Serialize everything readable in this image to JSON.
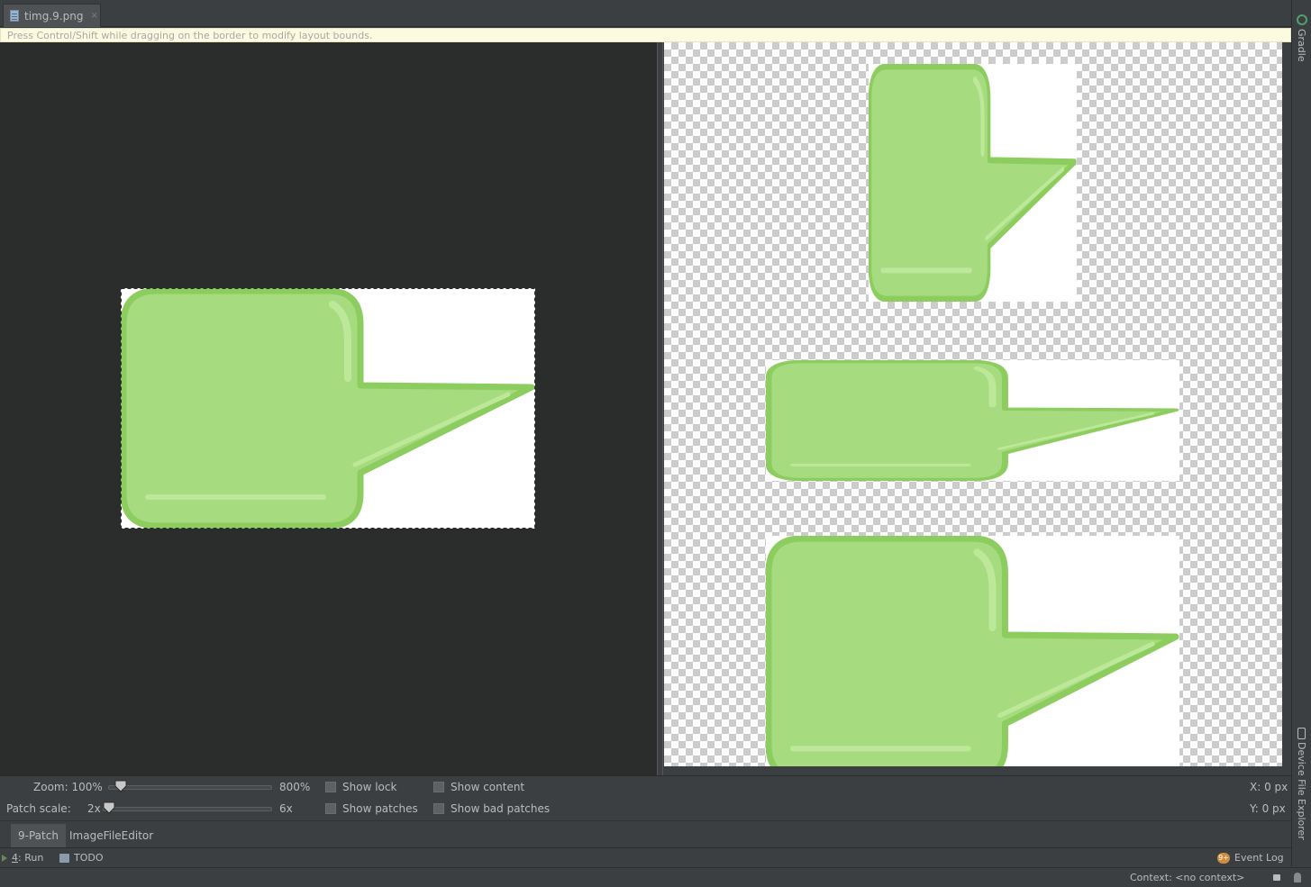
{
  "file_tab": {
    "title": "timg.9.png",
    "close": "×"
  },
  "hint": "Press Control/Shift while dragging on the border to modify layout bounds.",
  "right_strip": {
    "gradle": "Gradle",
    "device_file_explorer": "Device File Explorer"
  },
  "controls": {
    "zoom_label": "Zoom: 100%",
    "zoom_max": "800%",
    "zoom_level": 0.04,
    "patch_scale_label": "Patch scale:",
    "patch_scale_value": "2x",
    "patch_scale_max": "6x",
    "patch_scale_level": 0.0,
    "show_lock": "Show lock",
    "show_content": "Show content",
    "show_patches": "Show patches",
    "show_bad_patches": "Show bad patches",
    "x_readout": "X: 0 px",
    "y_readout": "Y: 0 px"
  },
  "editor_tabs": [
    {
      "label": "9-Patch",
      "active": true
    },
    {
      "label": "ImageFileEditor",
      "active": false
    }
  ],
  "tool_windows": {
    "run_number": "4",
    "run_label": ": Run",
    "todo": "TODO",
    "event_log": "Event Log",
    "event_badge": "9+"
  },
  "status": {
    "context": "Context: <no context>"
  },
  "colors": {
    "bubble_fill": "#a6dc7f",
    "bubble_edge": "#8dcc5f",
    "bubble_highlight": "#bde89a",
    "editor_bg": "#2b2d2d",
    "panel_bg": "#3c3f41",
    "hint_bg": "#fdfbdf"
  }
}
